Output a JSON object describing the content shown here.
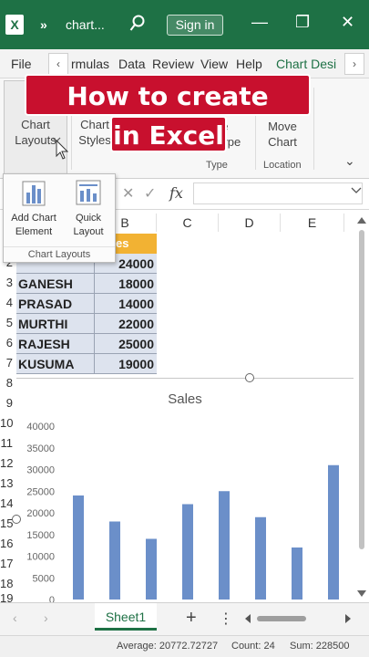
{
  "titlebar": {
    "app_logo": "X",
    "overflow": "»",
    "file_name": "chart...",
    "sign_in": "Sign in",
    "minimize": "—",
    "restore": "❐",
    "close": "✕"
  },
  "ribbon_tabs": {
    "file": "File",
    "items": [
      "rmulas",
      "Data",
      "Review",
      "View",
      "Help"
    ],
    "active": "Chart Desi",
    "scroll_left": "‹",
    "scroll_right": "›"
  },
  "ribbon": {
    "chart_layouts": "Chart\nLayouts",
    "chart_styles": "Chart\nStyles",
    "change_type_partial": "ge\nType",
    "move_chart": "Move\nChart",
    "group_type": "Type",
    "group_location": "Location",
    "collapse": "⌄"
  },
  "banner": {
    "line1": "How to create Charts",
    "line2": "in Excel"
  },
  "formula_bar": {
    "cancel": "✕",
    "enter": "✓",
    "fx": "fx",
    "value": ""
  },
  "dropdown": {
    "add_chart_element": "Add Chart\nElement",
    "quick_layout": "Quick\nLayout",
    "group": "Chart Layouts"
  },
  "columns": [
    "B",
    "C",
    "D",
    "E"
  ],
  "rows": [
    "2",
    "3",
    "4",
    "5",
    "6",
    "7",
    "8",
    "9",
    "10",
    "11",
    "12",
    "13",
    "14",
    "15",
    "16",
    "17",
    "18",
    "19"
  ],
  "sales_header": "es",
  "table": [
    {
      "name": "",
      "value": "24000"
    },
    {
      "name": "GANESH",
      "value": "18000"
    },
    {
      "name": "PRASAD",
      "value": "14000"
    },
    {
      "name": "MURTHI",
      "value": "22000"
    },
    {
      "name": "RAJESH",
      "value": "25000"
    },
    {
      "name": "KUSUMA",
      "value": "19000"
    }
  ],
  "chart": {
    "title": "Sales",
    "y_ticks": [
      "40000",
      "35000",
      "30000",
      "25000",
      "20000",
      "15000",
      "10000",
      "5000",
      "0"
    ],
    "bar_color": "#6b8fc9"
  },
  "chart_data": {
    "type": "bar",
    "title": "Sales",
    "xlabel": "",
    "ylabel": "",
    "ylim": [
      0,
      40000
    ],
    "values": [
      24000,
      18000,
      14000,
      22000,
      25000,
      19000,
      12000,
      31000
    ],
    "grid": false,
    "legend": "none"
  },
  "sheetbar": {
    "prev": "‹",
    "next": "›",
    "sheet": "Sheet1",
    "add": "+",
    "more": "⋮"
  },
  "status": {
    "average": "Average: 20772.72727",
    "count": "Count: 24",
    "sum": "Sum: 228500"
  }
}
